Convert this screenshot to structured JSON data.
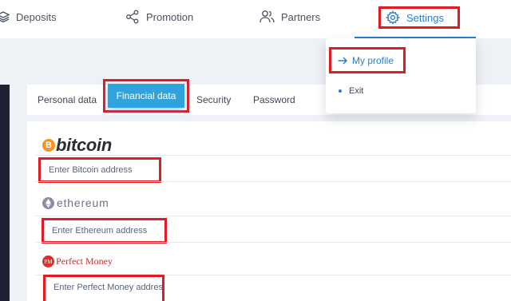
{
  "nav": {
    "deposits": "Deposits",
    "promotion": "Promotion",
    "partners": "Partners",
    "settings": "Settings"
  },
  "settings_menu": {
    "my_profile": "My profile",
    "exit": "Exit"
  },
  "tabs": {
    "personal": "Personal data",
    "financial": "Financial data",
    "security": "Security",
    "password": "Password"
  },
  "brands": {
    "bitcoin": "bitcoin",
    "bitcoin_symbol": "B",
    "ethereum": "ethereum",
    "perfect_money": "Perfect Money",
    "perfect_money_symbol": "PM"
  },
  "fields": {
    "bitcoin_placeholder": "Enter Bitcoin address",
    "ethereum_placeholder": "Enter Ethereum address",
    "perfect_money_placeholder": "Enter Perfect Money address"
  },
  "colors": {
    "accent": "#2a7fc8",
    "active_tab": "#2fa3dc",
    "highlight_box": "#e21b23",
    "bitcoin_brand": "#f7931a",
    "perfect_money_brand": "#c2302a"
  },
  "icons": {
    "deposits": "layers-icon",
    "promotion": "share-icon",
    "partners": "users-icon",
    "settings": "gear-icon",
    "my_profile": "arrow-right-icon"
  }
}
